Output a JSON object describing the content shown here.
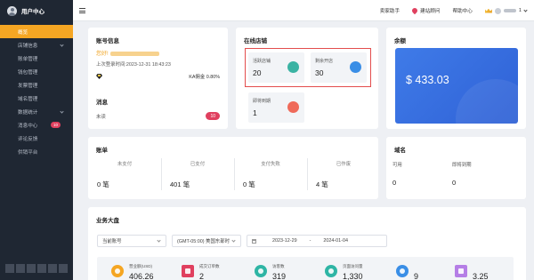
{
  "sidebar": {
    "title": "用户中心",
    "items": [
      {
        "label": "概览",
        "active": true
      },
      {
        "label": "店铺信息",
        "chevron": true
      },
      {
        "label": "账单管理"
      },
      {
        "label": "钱包管理"
      },
      {
        "label": "发票管理"
      },
      {
        "label": "域名管理"
      },
      {
        "label": "数据统计",
        "chevron": true
      },
      {
        "label": "消息中心",
        "badge": "10"
      },
      {
        "label": "评论反馈"
      },
      {
        "label": "供销平台"
      }
    ]
  },
  "topbar": {
    "links": {
      "seller_helper": "卖家助手",
      "site_advisor": "建站顾问",
      "help_center": "帮助中心"
    },
    "user_suffix": "1"
  },
  "account": {
    "title": "账号信息",
    "greeting": "您好!",
    "last_login": "上次登录时间:2023-12-31 18:43:23",
    "ka_label": "KA佣金 0.80%",
    "message_title": "消息",
    "unread_label": "未读",
    "unread_count": "10"
  },
  "stores": {
    "title": "在线店铺",
    "active_label": "活跃店铺",
    "active_value": "20",
    "remaining_label": "剩余开店",
    "remaining_value": "30",
    "expiring_label": "即将到期",
    "expiring_value": "1"
  },
  "balance": {
    "title": "余额",
    "value": "$ 433.03"
  },
  "bills": {
    "title": "账单",
    "columns": [
      {
        "label": "未支付",
        "value": "0 笔"
      },
      {
        "label": "已支付",
        "value": "401 笔"
      },
      {
        "label": "支付失败",
        "value": "0 笔"
      },
      {
        "label": "已作废",
        "value": "4 笔"
      }
    ]
  },
  "domains": {
    "title": "域名",
    "available_label": "可用",
    "available_value": "0",
    "expiring_label": "即将到期",
    "expiring_value": "0"
  },
  "dashboard": {
    "title": "业务大盘",
    "account_select": "当前账号",
    "timezone_select": "(GMT-05:00) 美国东部时",
    "date_start": "2023-12-29",
    "date_sep": "-",
    "date_end": "2024-01-04",
    "kpis": [
      {
        "label": "营业额(USD)",
        "value": "406.26",
        "color": "#f5a623",
        "icon": "dollar-icon"
      },
      {
        "label": "成交订单数",
        "value": "2",
        "color": "#e0405f",
        "icon": "order-list-icon"
      },
      {
        "label": "访客数",
        "value": "319",
        "color": "#2fb5a5",
        "icon": "visitor-icon"
      },
      {
        "label": "页面访问量",
        "value": "1,330",
        "color": "#2fb5a5",
        "icon": "eye-icon"
      },
      {
        "label": "",
        "value": "9",
        "color": "#3a8ee6",
        "icon": "user-add-icon"
      },
      {
        "label": "",
        "value": "3.25",
        "color": "#b57ee6",
        "icon": "document-icon"
      }
    ]
  }
}
